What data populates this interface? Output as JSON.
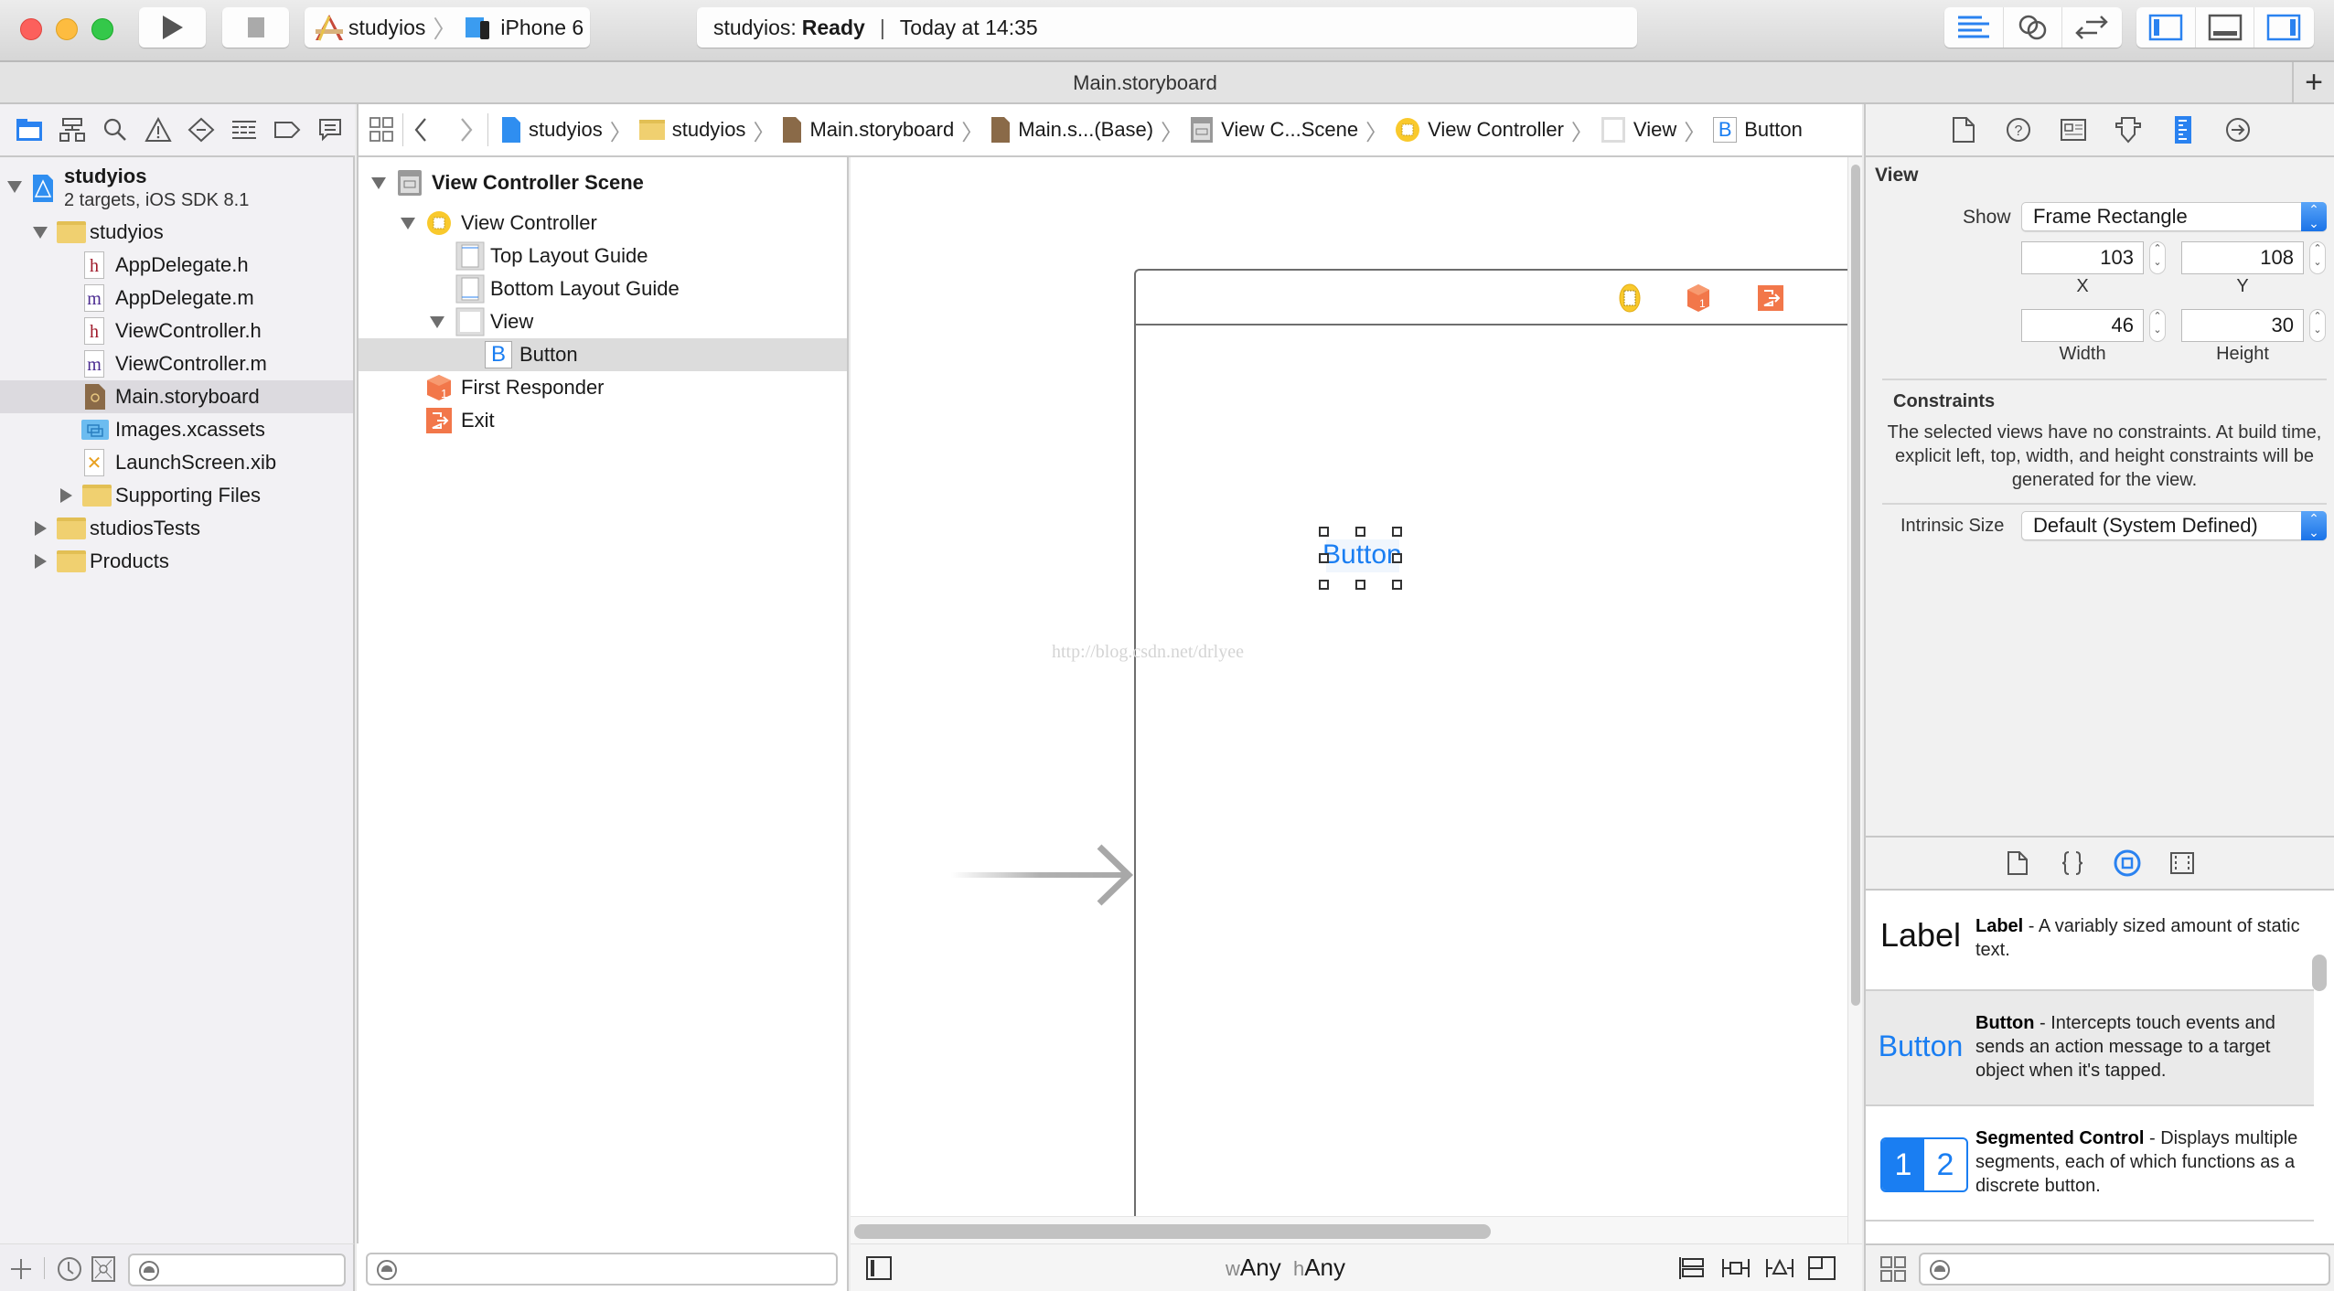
{
  "window": {
    "traffic_lights": {
      "close": "#fc605c",
      "minimize": "#fdbc40",
      "zoom": "#34c84a"
    }
  },
  "toolbar": {
    "run_icon": "play-icon",
    "stop_icon": "stop-icon",
    "scheme": {
      "project": "studyios",
      "device": "iPhone 6"
    },
    "status": {
      "project": "studyios:",
      "state": "Ready",
      "separator": "|",
      "time": "Today at 14:35"
    },
    "editor_buttons": [
      "standard-editor",
      "assistant-editor",
      "version-editor"
    ],
    "view_buttons": [
      "navigator-toggle",
      "debug-area-toggle",
      "utilities-toggle"
    ]
  },
  "tabbar": {
    "title": "Main.storyboard",
    "add_tab": "+"
  },
  "navigator": {
    "tabs": [
      "project",
      "symbol",
      "find",
      "issue",
      "test",
      "debug",
      "breakpoint",
      "report"
    ],
    "project": {
      "name": "studyios",
      "subtitle": "2 targets, iOS SDK 8.1"
    },
    "items": [
      {
        "label": "studyios",
        "type": "folder",
        "level": 1,
        "expanded": true
      },
      {
        "label": "AppDelegate.h",
        "type": "h",
        "level": 2
      },
      {
        "label": "AppDelegate.m",
        "type": "m",
        "level": 2
      },
      {
        "label": "ViewController.h",
        "type": "h",
        "level": 2
      },
      {
        "label": "ViewController.m",
        "type": "m",
        "level": 2
      },
      {
        "label": "Main.storyboard",
        "type": "storyboard",
        "level": 2,
        "selected": true
      },
      {
        "label": "Images.xcassets",
        "type": "xcassets",
        "level": 2
      },
      {
        "label": "LaunchScreen.xib",
        "type": "xib",
        "level": 2
      },
      {
        "label": "Supporting Files",
        "type": "folder",
        "level": 2,
        "expanded": false
      },
      {
        "label": "studiosTests",
        "type": "folder",
        "level": 1,
        "expanded": false
      },
      {
        "label": "Products",
        "type": "folder",
        "level": 1,
        "expanded": false
      }
    ]
  },
  "jumpbar": {
    "crumbs": [
      "studyios",
      "studyios",
      "Main.storyboard",
      "Main.s...(Base)",
      "View C...Scene",
      "View Controller",
      "View",
      "Button"
    ]
  },
  "outline": {
    "items": [
      {
        "label": "View Controller Scene",
        "bold": true
      },
      {
        "label": "View Controller"
      },
      {
        "label": "Top Layout Guide"
      },
      {
        "label": "Bottom Layout Guide"
      },
      {
        "label": "View"
      },
      {
        "label": "Button",
        "selected": true
      },
      {
        "label": "First Responder"
      },
      {
        "label": "Exit"
      }
    ]
  },
  "canvas": {
    "button_title": "Button",
    "watermark": "http://blog.csdn.net/drlyee",
    "size_class": {
      "w_prefix": "w",
      "w_value": "Any",
      "h_prefix": "h",
      "h_value": "Any"
    }
  },
  "inspector": {
    "tabs": [
      "file",
      "quick-help",
      "identity",
      "attributes",
      "size",
      "connections"
    ],
    "section_title": "View",
    "show_label": "Show",
    "show_value": "Frame Rectangle",
    "x": {
      "value": "103",
      "caption": "X"
    },
    "y": {
      "value": "108",
      "caption": "Y"
    },
    "width": {
      "value": "46",
      "caption": "Width"
    },
    "height": {
      "value": "30",
      "caption": "Height"
    },
    "constraints_title": "Constraints",
    "constraints_text": "The selected views have no constraints. At build time, explicit left, top, width, and height constraints will be generated for the view.",
    "intrinsic_label": "Intrinsic Size",
    "intrinsic_value": "Default (System Defined)"
  },
  "library": {
    "tabs": [
      "file-template",
      "code-snippet",
      "object",
      "media"
    ],
    "items": [
      {
        "preview": "Label",
        "name": "Label",
        "desc": " - A variably sized amount of static text."
      },
      {
        "preview": "Button",
        "name": "Button",
        "desc": " - Intercepts touch events and sends an action message to a target object when it's tapped."
      },
      {
        "preview_1": "1",
        "preview_2": "2",
        "name": "Segmented Control",
        "desc": " - Displays multiple segments, each of which functions as a discrete button."
      }
    ]
  },
  "colors": {
    "accent": "#1a7ef2",
    "selection": "#dcdadf",
    "exit_orange": "#f2774a",
    "vc_yellow": "#f9c92c"
  }
}
